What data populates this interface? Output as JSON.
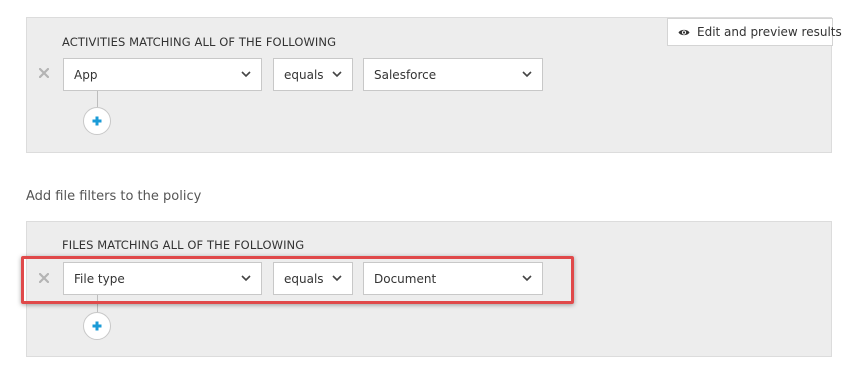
{
  "activities_panel": {
    "heading": "ACTIVITIES MATCHING ALL OF THE FOLLOWING",
    "filter": {
      "field": "App",
      "operator": "equals",
      "value": "Salesforce"
    },
    "icons": {
      "remove": "close-icon",
      "add": "plus-icon",
      "dropdown": "chevron-down-icon"
    }
  },
  "preview_button": {
    "label": "Edit and preview results",
    "icon": "eye-icon"
  },
  "file_filters_section": {
    "label": "Add file filters to the policy"
  },
  "files_panel": {
    "heading": "FILES MATCHING ALL OF THE FOLLOWING",
    "filter": {
      "field": "File type",
      "operator": "equals",
      "value": "Document"
    },
    "icons": {
      "remove": "close-icon",
      "add": "plus-icon",
      "dropdown": "chevron-down-icon"
    }
  },
  "colors": {
    "panel_background": "#ededed",
    "add_icon": "#1a9bd7",
    "highlight_border": "#e0494a"
  }
}
